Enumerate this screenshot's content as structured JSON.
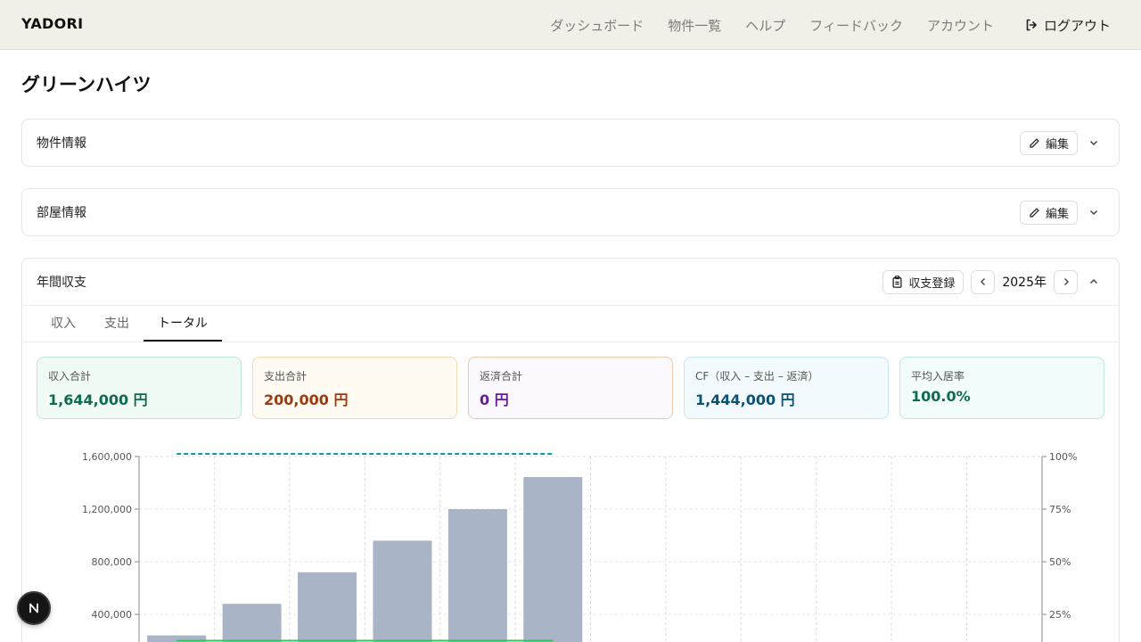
{
  "app": {
    "brand": "YADORI"
  },
  "nav": {
    "links": [
      "ダッシュボード",
      "物件一覧",
      "ヘルプ",
      "フィードバック",
      "アカウント"
    ],
    "logout": "ログアウト"
  },
  "page": {
    "title": "グリーンハイツ"
  },
  "sections": {
    "property": {
      "title": "物件情報",
      "edit": "編集"
    },
    "rooms": {
      "title": "部屋情報",
      "edit": "編集"
    },
    "annual": {
      "title": "年間収支",
      "register": "収支登録",
      "year": "2025年"
    }
  },
  "tabs": [
    "収入",
    "支出",
    "トータル"
  ],
  "stats": [
    {
      "label": "収入合計",
      "value": "1,644,000 円",
      "color": "#0f6b4f",
      "bg": "#f1fbf6",
      "border": "#bfe8d3"
    },
    {
      "label": "支出合計",
      "value": "200,000 円",
      "color": "#9a3b12",
      "bg": "#fffaf2",
      "border": "#f3d9b3"
    },
    {
      "label": "返済合計",
      "value": "0 円",
      "color": "#6a1b9a",
      "bg": "#fbf8fe",
      "border": "#e9c9a8"
    },
    {
      "label": "CF（収入 – 支出 – 返済）",
      "value": "1,444,000 円",
      "color": "#0b5275",
      "bg": "#f3fafd",
      "border": "#c5e6f2"
    },
    {
      "label": "平均入居率",
      "value": "100.0%",
      "color": "#0f6b4f",
      "bg": "#f2fcfa",
      "border": "#bfe8e0"
    }
  ],
  "chart_data": {
    "type": "bar",
    "y_left_ticks": [
      "400,000",
      "800,000",
      "1,200,000",
      "1,600,000"
    ],
    "y_right_ticks": [
      "25%",
      "50%",
      "75%",
      "100%"
    ],
    "ylim": [
      0,
      1600000
    ],
    "months": 12,
    "bar_color": "#a9b4c6",
    "bars": [
      240000,
      480000,
      720000,
      960000,
      1200000,
      1444000
    ],
    "occupancy_line": {
      "color": "#0f9aa8",
      "values": [
        100,
        100,
        100,
        100,
        100,
        100
      ]
    },
    "green_line": {
      "color": "#3cc06a",
      "values": [
        200000,
        200000,
        200000,
        200000,
        200000,
        200000
      ]
    }
  }
}
